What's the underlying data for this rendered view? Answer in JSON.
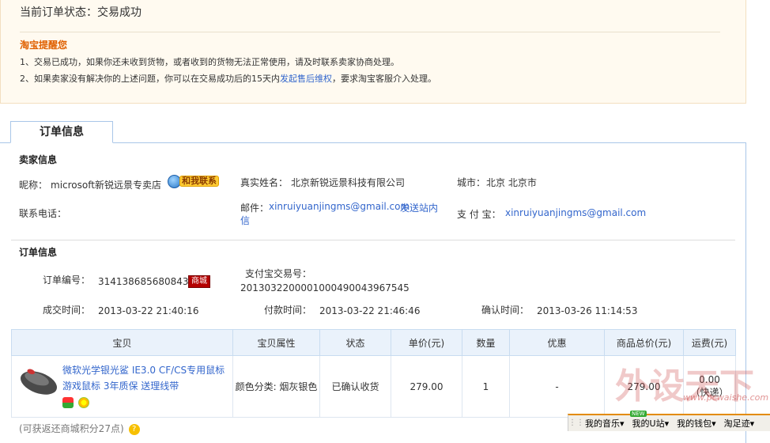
{
  "status": {
    "label": "当前订单状态：",
    "value": "交易成功"
  },
  "reminder": {
    "title": "淘宝提醒您",
    "line1": "1、交易已成功，如果你还未收到货物，或者收到的货物无法正常使用，请及时联系卖家协商处理。",
    "line2_pre": "2、如果卖家没有解决你的上述问题，你可以在交易成功后的15天内",
    "line2_link": "发起售后维权",
    "line2_post": "，要求淘宝客服介入处理。"
  },
  "tab": {
    "label": "订单信息"
  },
  "seller": {
    "section_title": "卖家信息",
    "nickname_label": "昵称：",
    "nickname_value": "microsoft新锐远景专卖店",
    "contact_button": "和我联系",
    "realname_label": "真实姓名：",
    "realname_value": "北京新锐远景科技有限公司",
    "city_label": "城市：",
    "city_value": "北京 北京市",
    "phone_label": "联系电话：",
    "email_label": "邮件：",
    "email_value": "xinruiyuanjingms@gmail.com",
    "send_message_line1": "发送站内",
    "send_message_line2": "信",
    "alipay_label": "支 付 宝：",
    "alipay_value": "xinruiyuanjingms@gmail.com"
  },
  "order": {
    "section_title": "订单信息",
    "order_no_label": "订单编号：",
    "order_no_value": "314138685680843",
    "mall_badge": "商城",
    "alipay_trade_label": "支付宝交易号：",
    "alipay_trade_value": "2013032200001000490043967545",
    "deal_time_label": "成交时间：",
    "deal_time_value": "2013-03-22 21:40:16",
    "pay_time_label": "付款时间：",
    "pay_time_value": "2013-03-22 21:46:46",
    "confirm_time_label": "确认时间：",
    "confirm_time_value": "2013-03-26 11:14:53"
  },
  "table": {
    "headers": [
      "宝贝",
      "宝贝属性",
      "状态",
      "单价(元)",
      "数量",
      "优惠",
      "商品总价(元)",
      "运费(元)"
    ],
    "row": {
      "title": "微软光学银光鲨 IE3.0 CF/CS专用鼠标 游戏鼠标 3年质保 送理线带",
      "attr": "颜色分类: 烟灰银色",
      "status": "已确认收货",
      "unit_price": "279.00",
      "quantity": "1",
      "discount": "-",
      "total": "279.00",
      "shipping": "0.00",
      "shipping_note": "（快递）"
    }
  },
  "footnote": {
    "text": "(可获返还商城积分27点)"
  },
  "watermark": {
    "text": "外设天下",
    "url": "www.pcwaishe.com"
  },
  "taskbar": {
    "items": [
      "我的音乐▾",
      "我的U站▾",
      "我的钱包▾",
      "淘足迹▾"
    ],
    "new_badge": "NEW"
  }
}
